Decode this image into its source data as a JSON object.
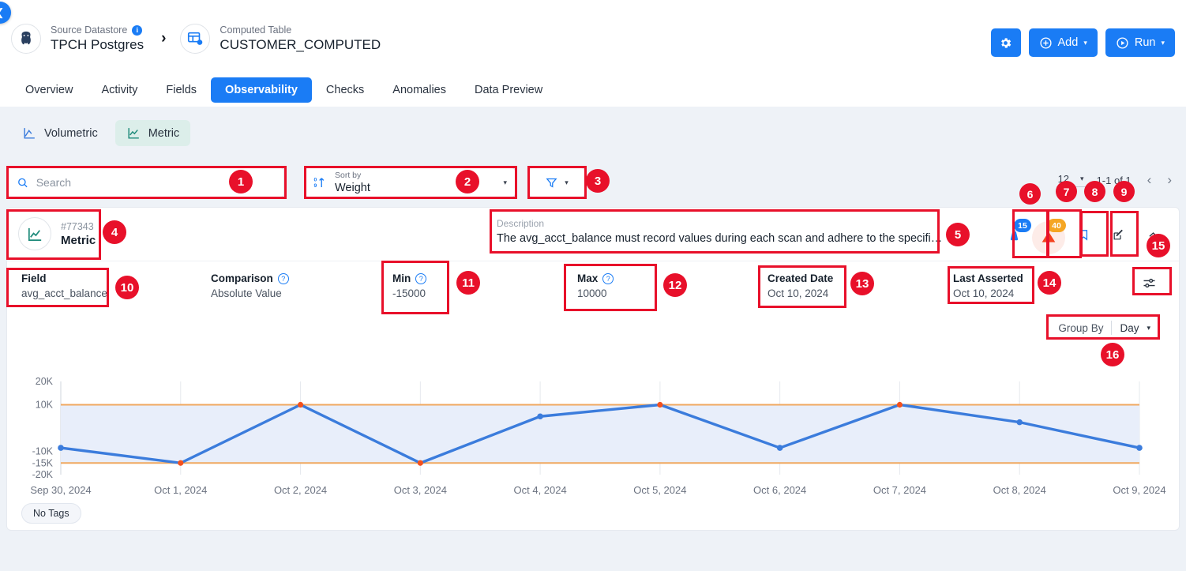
{
  "header": {
    "collapse_icon": "chevron-left-icon",
    "breadcrumb": [
      {
        "label": "Source Datastore",
        "value": "TPCH Postgres",
        "icon": "postgres-elephant-icon",
        "has_info": true
      },
      {
        "label": "Computed Table",
        "value": "CUSTOMER_COMPUTED",
        "icon": "computed-table-icon",
        "has_info": false
      }
    ],
    "separator": "›",
    "actions": {
      "settings_label": "",
      "settings_icon": "gear-icon",
      "add_label": "Add",
      "add_icon": "plus-circle-icon",
      "run_label": "Run",
      "run_icon": "play-circle-icon",
      "caret": "▾"
    },
    "tabs": [
      {
        "label": "Overview",
        "active": false
      },
      {
        "label": "Activity",
        "active": false
      },
      {
        "label": "Fields",
        "active": false
      },
      {
        "label": "Observability",
        "active": true
      },
      {
        "label": "Checks",
        "active": false
      },
      {
        "label": "Anomalies",
        "active": false
      },
      {
        "label": "Data Preview",
        "active": false
      }
    ]
  },
  "subtabs": [
    {
      "label": "Volumetric",
      "icon": "volumetric-chart-icon",
      "active": false
    },
    {
      "label": "Metric",
      "icon": "metric-chart-icon",
      "active": true
    }
  ],
  "toolbar": {
    "search": {
      "placeholder": "Search",
      "value": "",
      "icon": "search-icon"
    },
    "sort": {
      "label": "Sort by",
      "value": "Weight",
      "icon": "sort-ascending-icon",
      "caret": "▾"
    },
    "filter": {
      "icon": "filter-funnel-icon",
      "caret": "▾"
    },
    "pager": {
      "page_size": "12",
      "caret": "▾",
      "range": "1-1 of 1",
      "prev": "‹",
      "next": "›"
    }
  },
  "card": {
    "metric": {
      "id": "#77343",
      "type": "Metric",
      "icon": "metric-line-chart-icon"
    },
    "description": {
      "label": "Description",
      "value": "The avg_acct_balance must record values during each scan and adhere to the specifie…"
    },
    "icons": {
      "weight": {
        "name": "weight-icon",
        "badge": "15"
      },
      "anomaly": {
        "name": "warning-triangle-icon",
        "badge": "40"
      },
      "bookmark": {
        "name": "bookmark-icon"
      },
      "edit": {
        "name": "edit-square-icon"
      },
      "collapse": {
        "name": "chevron-up-icon"
      },
      "settings": {
        "name": "sliders-icon"
      }
    },
    "attributes": [
      {
        "label": "Field",
        "value": "avg_acct_balance",
        "help": false
      },
      {
        "label": "Comparison",
        "value": "Absolute Value",
        "help": true
      },
      {
        "label": "Min",
        "value": "-15000",
        "help": true
      },
      {
        "label": "Max",
        "value": "10000",
        "help": true
      },
      {
        "label": "Created Date",
        "value": "Oct 10, 2024",
        "help": false
      },
      {
        "label": "Last Asserted",
        "value": "Oct 10, 2024",
        "help": false
      }
    ],
    "group_by": {
      "label": "Group By",
      "value": "Day",
      "caret": "▾"
    },
    "tags": {
      "empty_label": "No Tags"
    }
  },
  "chart_data": {
    "type": "line",
    "title": "",
    "xlabel": "",
    "ylabel": "",
    "x": [
      "Sep 30, 2024",
      "Oct 1, 2024",
      "Oct 2, 2024",
      "Oct 3, 2024",
      "Oct 4, 2024",
      "Oct 5, 2024",
      "Oct 6, 2024",
      "Oct 7, 2024",
      "Oct 8, 2024",
      "Oct 9, 2024"
    ],
    "series": [
      {
        "name": "avg_acct_balance",
        "color": "#3b7cdc",
        "values": [
          -8500,
          -15000,
          10000,
          -15000,
          5000,
          10000,
          -8500,
          10000,
          2500,
          -8500
        ],
        "breach_flags": [
          false,
          true,
          true,
          true,
          false,
          true,
          false,
          true,
          false,
          false
        ]
      }
    ],
    "ytick_labels": [
      "20K",
      "10K",
      "-10K",
      "-15K",
      "-20K"
    ],
    "ytick_values": [
      20000,
      10000,
      -10000,
      -15000,
      -20000
    ],
    "ylim": [
      -20000,
      20000
    ],
    "thresholds": [
      {
        "name": "Max",
        "value": 10000,
        "color": "#f0a860"
      },
      {
        "name": "Min",
        "value": -15000,
        "color": "#f0a860"
      }
    ],
    "band_fill": "#e8eefa",
    "grid": true,
    "legend": "none",
    "point_normal_color": "#3b7cdc",
    "point_breach_color": "#f4511e"
  },
  "annotations": [
    {
      "num": "1",
      "label": "search-input"
    },
    {
      "num": "2",
      "label": "sort-by-dropdown"
    },
    {
      "num": "3",
      "label": "filter-button"
    },
    {
      "num": "4",
      "label": "metric-identity"
    },
    {
      "num": "5",
      "label": "description-field"
    },
    {
      "num": "6",
      "label": "page-size-selector"
    },
    {
      "num": "7",
      "label": "page-size-caret"
    },
    {
      "num": "8",
      "label": "page-range"
    },
    {
      "num": "9",
      "label": "page-next"
    },
    {
      "num": "10",
      "label": "field-attribute"
    },
    {
      "num": "11",
      "label": "min-attribute"
    },
    {
      "num": "12",
      "label": "max-attribute"
    },
    {
      "num": "13",
      "label": "created-date-attribute"
    },
    {
      "num": "14",
      "label": "last-asserted-attribute"
    },
    {
      "num": "15",
      "label": "collapse-card-button"
    },
    {
      "num": "16",
      "label": "group-by-dropdown"
    }
  ],
  "colors": {
    "accent": "#1a7cf5",
    "page_bg": "#eef2f7",
    "threshold": "#f0a860",
    "series": "#3b7cdc",
    "breach_point": "#f4511e",
    "annotation": "#e8102a"
  }
}
